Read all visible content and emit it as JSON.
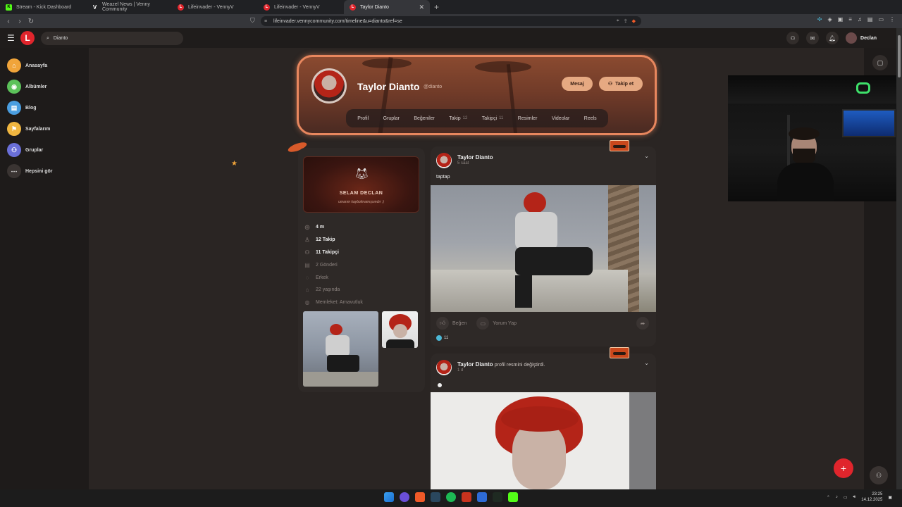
{
  "browser": {
    "tabs": [
      {
        "title": "Stream - Kick Dashboard",
        "fav": "K",
        "color": "#53fc18"
      },
      {
        "title": "Weazel News | Venny Community",
        "fav": "V",
        "color": "#444444"
      },
      {
        "title": "Lifeinvader - VennyV",
        "fav": "L",
        "color": "#e0252c"
      },
      {
        "title": "Lifeinvader - VennyV",
        "fav": "L",
        "color": "#e0252c"
      },
      {
        "title": "Taylor Dianto",
        "fav": "L",
        "color": "#e0252c"
      }
    ],
    "url": "lifeinvader.vennycommunity.com/timeline&u=dianto&ref=se"
  },
  "header": {
    "search_value": "Dianto",
    "user_name": "Declan"
  },
  "sidebar": {
    "items": [
      {
        "label": "Anasayfa",
        "icon": "home-icon",
        "color": "#f0a43a"
      },
      {
        "label": "Albümler",
        "icon": "album-icon",
        "color": "#5cc25a"
      },
      {
        "label": "Blog",
        "icon": "blog-icon",
        "color": "#4a9ee0"
      },
      {
        "label": "Sayfalarım",
        "icon": "flag-icon",
        "color": "#f0b640"
      },
      {
        "label": "Gruplar",
        "icon": "groups-icon",
        "color": "#6a6fd8"
      },
      {
        "label": "Hepsini gör",
        "icon": "more-icon",
        "color": "#3a3432"
      }
    ]
  },
  "profile": {
    "name": "Taylor Dianto",
    "handle": "@dianto",
    "message_label": "Mesaj",
    "follow_label": "Takip et",
    "tabs": [
      {
        "label": "Profil",
        "count": ""
      },
      {
        "label": "Gruplar",
        "count": ""
      },
      {
        "label": "Beğeniler",
        "count": ""
      },
      {
        "label": "Takip",
        "count": "12"
      },
      {
        "label": "Takipçi",
        "count": "11"
      },
      {
        "label": "Resimler",
        "count": ""
      },
      {
        "label": "Videolar",
        "count": ""
      },
      {
        "label": "Reels",
        "count": ""
      }
    ]
  },
  "info": {
    "banner_title": "SELAM DECLAN",
    "banner_subtitle": "umarım kaybolmamışsındır :)",
    "rows": [
      {
        "text": "4 m",
        "icon": "eye-icon",
        "highlight": true
      },
      {
        "text": "12 Takip",
        "icon": "user-icon",
        "highlight": true
      },
      {
        "text": "11 Takipçi",
        "icon": "users-icon",
        "highlight": true
      },
      {
        "text": "2 Gönderi",
        "icon": "document-icon",
        "highlight": false
      },
      {
        "text": "Erkek",
        "icon": "gender-icon",
        "highlight": false
      },
      {
        "text": "22 yaşında",
        "icon": "cake-icon",
        "highlight": false
      },
      {
        "text": "Memleket: Arnavutluk",
        "icon": "globe-icon",
        "highlight": false
      }
    ]
  },
  "posts": [
    {
      "author": "Taylor Dianto",
      "action": "",
      "time": "5 saat",
      "text": "taptap",
      "like_label": "Beğen",
      "comment_label": "Yorum Yap",
      "reaction_count": "11"
    },
    {
      "author": "Taylor Dianto",
      "action": "profil resmini değiştirdi.",
      "time": "1 d"
    }
  ],
  "taskbar": {
    "time": "23:25",
    "date": "14.12.2025"
  }
}
